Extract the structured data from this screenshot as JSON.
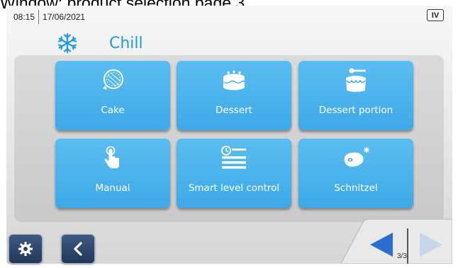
{
  "caption": "Window: product selection page 3",
  "status": {
    "time": "08:15",
    "date": "17/06/2021",
    "mode_badge": "IV"
  },
  "header": {
    "title": "Chill",
    "icon": "snowflake-icon"
  },
  "tiles": [
    {
      "label": "Cake",
      "icon": "cake-tart-icon"
    },
    {
      "label": "Dessert",
      "icon": "layer-cake-icon"
    },
    {
      "label": "Dessert portion",
      "icon": "dessert-portion-icon"
    },
    {
      "label": "Manual",
      "icon": "touch-hand-icon"
    },
    {
      "label": "Smart level control",
      "icon": "smart-level-icon"
    },
    {
      "label": "Schnitzel",
      "icon": "schnitzel-icon"
    }
  ],
  "footer": {
    "settings_icon": "gear-icon",
    "back_icon": "chevron-left-icon",
    "page_indicator": "3/3",
    "colors": {
      "prev_arrow": "#2a6fcf",
      "next_arrow_disabled": "#c9d6ea"
    }
  },
  "colors": {
    "tile": "#46b0ec",
    "title": "#1f9be0",
    "button": "#2b4366"
  }
}
